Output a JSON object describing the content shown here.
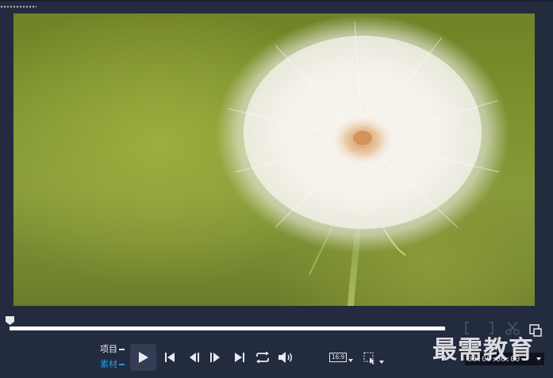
{
  "media": {
    "subject": "dandelion-seed-head-photo"
  },
  "mode_switch": {
    "project_label": "项目",
    "clip_label": "素材",
    "active": "素材"
  },
  "controls": {
    "play": "play-icon",
    "go_start": "skip-to-start-icon",
    "prev_frame": "previous-frame-icon",
    "next_frame": "next-frame-icon",
    "go_end": "skip-to-end-icon",
    "repeat": "repeat-icon",
    "volume": "volume-icon",
    "aspect_ratio": "16:9",
    "pointer": "pointer-select-icon"
  },
  "scrubber": {
    "position": 0.0
  },
  "timecode": {
    "value": "00:00:00:00"
  },
  "watermark": {
    "text": "最需教育"
  },
  "colors": {
    "background": "#232b3f",
    "accent": "#1e9de8",
    "text": "#e9ebf0"
  }
}
